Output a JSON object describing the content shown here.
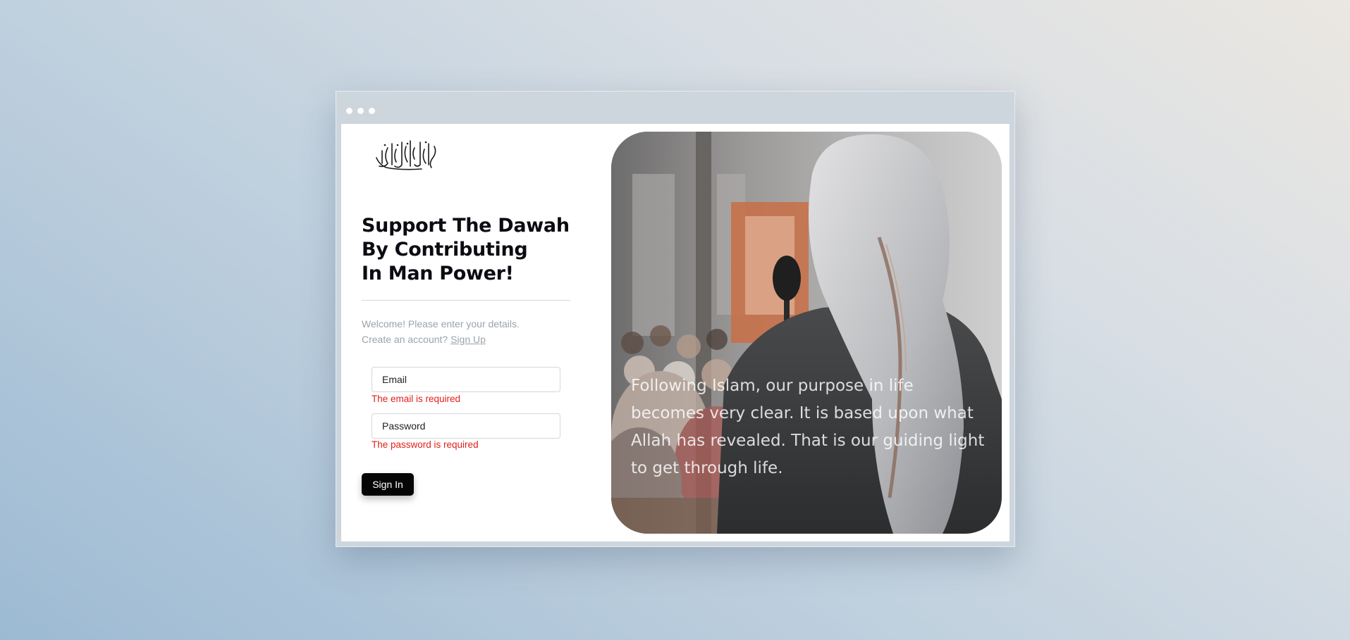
{
  "window": {
    "controls": [
      "dot-1",
      "dot-2",
      "dot-3"
    ]
  },
  "logo": {
    "alt": "Arabic calligraphy logo",
    "text": "مركز الدعوة الإسلامية"
  },
  "headline": "Support The Dawah\nBy Contributing\nIn Man Power!",
  "welcome_text": "Welcome! Please enter your details.",
  "create_account": {
    "prefix": "Create an account?",
    "link_label": "Sign Up"
  },
  "form": {
    "email": {
      "placeholder": "Email",
      "value": "",
      "error": "The email is required"
    },
    "password": {
      "placeholder": "Password",
      "value": "",
      "error": "The password is required"
    },
    "submit_label": "Sign In"
  },
  "hero": {
    "image_alt": "Speaker wearing a white headscarf addressing a crowd at a microphone",
    "quote": "Following Islam, our purpose in life becomes very clear. It is based upon what Allah has revealed. That is our guiding light to get through life."
  },
  "colors": {
    "error": "#e0201c",
    "button_bg": "#050505",
    "muted_text": "#9aa3ad",
    "headline": "#0b0b12"
  }
}
